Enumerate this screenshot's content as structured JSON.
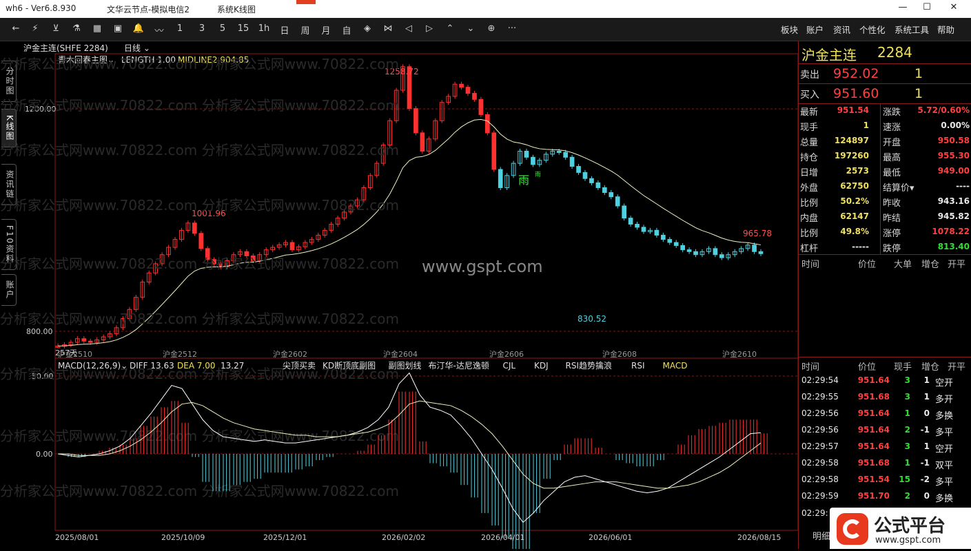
{
  "titlebar": {
    "left": "wh6 - Ver6.8.930",
    "center": "文华云节点-模拟电信2",
    "right": "系统K线图",
    "min": "—",
    "max": "☐",
    "close": "✕"
  },
  "toolbar": {
    "icons": [
      "←",
      "⚡",
      "⊻",
      "⚗",
      "▦",
      "▣",
      "🔔",
      "〰",
      "1",
      "3",
      "5",
      "15",
      "1h",
      "日",
      "周",
      "月",
      "自",
      "◈",
      "⋈",
      "◁",
      "▷",
      "⌃",
      "⌄",
      "⊕",
      "···"
    ],
    "menus": [
      "板块",
      "账户",
      "资讯",
      "个性化",
      "系统工具",
      "帮助"
    ]
  },
  "vtabs": [
    "分时图",
    "K线图",
    "资讯链",
    "F10资料",
    "账户"
  ],
  "header": {
    "symbol": "沪金主连(SHFE 2284)",
    "period": "日线",
    "indicator": "青木回春主图",
    "length": "LENGTH 1.00",
    "midline": "MIDLINE2 904.85"
  },
  "watermark_text": "www.gspt.com",
  "watermark_bg": "分析家公式网www.70822.com",
  "annotations": {
    "high": "1258.72",
    "peak1": "1001.96",
    "low": "830.52",
    "last_high": "965.78",
    "rain1": "雨",
    "rain2": "雨",
    "days": "257天"
  },
  "price_axis": [
    "1200.00",
    "800.00"
  ],
  "contract_labels": [
    "沪金2510",
    "沪金2512",
    "沪金2602",
    "沪金2604",
    "沪金2606",
    "沪金2608",
    "沪金2610"
  ],
  "macd": {
    "title": "MACD(12,26,9)",
    "diff": "DIFF 13.63",
    "dea": "DEA 7.00",
    "val": "13.27",
    "tabs": [
      "尖顶买卖",
      "KD断顶底副图",
      "副图划线",
      "布汀华-达尼逸顿",
      "CJL",
      "KDJ",
      "RSI趋势擒浪",
      "RSI",
      "MACD"
    ],
    "axis": [
      "50.00",
      "0.00"
    ]
  },
  "date_axis": [
    "2025/08/01",
    "2025/10/09",
    "2025/12/01",
    "2026/02/02",
    "2026/04/01",
    "2026/06/01",
    "2026/08/15"
  ],
  "quote": {
    "name": "沪金主连",
    "code": "2284",
    "sell": {
      "label": "卖出",
      "price": "952.02",
      "vol": "1"
    },
    "buy": {
      "label": "买入",
      "price": "951.60",
      "vol": "1"
    },
    "rows": [
      [
        "最新",
        "951.54",
        "red",
        "涨跌",
        "5.72/0.60%",
        "red"
      ],
      [
        "现手",
        "1",
        "yel",
        "速涨",
        "0.00%",
        "wht"
      ],
      [
        "总量",
        "124897",
        "yel",
        "开盘",
        "950.58",
        "red"
      ],
      [
        "持仓",
        "197260",
        "yel",
        "最高",
        "955.30",
        "red"
      ],
      [
        "日增",
        "2573",
        "yel",
        "最低",
        "949.00",
        "red"
      ],
      [
        "外盘",
        "62750",
        "yel",
        "结算价▾",
        "----",
        "wht"
      ],
      [
        "比例",
        "50.2%",
        "yel",
        "昨收",
        "943.16",
        "wht"
      ],
      [
        "内盘",
        "62147",
        "yel",
        "昨结",
        "945.82",
        "wht"
      ],
      [
        "比例",
        "49.8%",
        "yel",
        "涨停",
        "1078.22",
        "red"
      ],
      [
        "杠杆",
        "-----",
        "wht",
        "跌停",
        "813.40",
        "grn"
      ]
    ]
  },
  "t1_header": [
    "时间",
    "价位",
    "大单",
    "增仓",
    "开平"
  ],
  "t2_header": [
    "时间",
    "价位",
    "现手",
    "增仓",
    "开平"
  ],
  "ticks": [
    [
      "02:29:54",
      "951.64",
      "3",
      "1",
      "空开"
    ],
    [
      "02:29:55",
      "951.68",
      "3",
      "1",
      "多开"
    ],
    [
      "02:29:56",
      "951.64",
      "1",
      "0",
      "多换"
    ],
    [
      "02:29:56",
      "951.64",
      "2",
      "-1",
      "多平"
    ],
    [
      "02:29:57",
      "951.64",
      "3",
      "1",
      "空开"
    ],
    [
      "02:29:58",
      "951.68",
      "1",
      "-1",
      "双平"
    ],
    [
      "02:29:58",
      "951.54",
      "15",
      "-2",
      "多平"
    ],
    [
      "02:29:59",
      "951.70",
      "2",
      "0",
      "多换"
    ]
  ],
  "tick_last_time": "02:29:",
  "corner_logo": {
    "text": "公式平台",
    "url": "www.gspt.com"
  },
  "bottom_tab": "明细",
  "chart_data": {
    "type": "candlestick",
    "x_range": [
      "2025/08/01",
      "2026/08/15"
    ],
    "y_range": [
      780,
      1280
    ],
    "series": [
      {
        "name": "MIDLINE2",
        "values": []
      }
    ],
    "closes": [
      800,
      802,
      806,
      812,
      808,
      806,
      810,
      815,
      820,
      830,
      845,
      860,
      880,
      905,
      920,
      935,
      950,
      962,
      975,
      990,
      1001.96,
      985,
      960,
      942,
      935,
      930,
      940,
      950,
      955,
      948,
      940,
      950,
      958,
      962,
      966,
      970,
      958,
      963,
      970,
      975,
      982,
      990,
      1000,
      1010,
      1020,
      1030,
      1040,
      1060,
      1080,
      1100,
      1130,
      1170,
      1220,
      1258.72,
      1190,
      1150,
      1120,
      1140,
      1170,
      1200,
      1210,
      1230,
      1225,
      1215,
      1205,
      1180,
      1150,
      1090,
      1060,
      1080,
      1100,
      1120,
      1110,
      1098,
      1105,
      1115,
      1120,
      1118,
      1110,
      1095,
      1085,
      1075,
      1068,
      1060,
      1052,
      1045,
      1030,
      1010,
      1000,
      995,
      988,
      990,
      982,
      975,
      970,
      965,
      958,
      955,
      950,
      955,
      960,
      950,
      945,
      950,
      955,
      960,
      965.78,
      955,
      951.54
    ],
    "macd_diff": [
      0,
      -1,
      -2,
      -1,
      0,
      2,
      5,
      10,
      18,
      26,
      35,
      44,
      42,
      32,
      22,
      15,
      11,
      10,
      9,
      8,
      9,
      8,
      7,
      7,
      8,
      9,
      10,
      11,
      12,
      14,
      17,
      22,
      30,
      45,
      52,
      38,
      30,
      28,
      25,
      18,
      10,
      0,
      -10,
      -22,
      -35,
      -44,
      -38,
      -30,
      -24,
      -18,
      -15,
      -14,
      -16,
      -18,
      -20,
      -22,
      -24,
      -25,
      -24,
      -22,
      -18,
      -14,
      -10,
      -6,
      -2,
      3,
      8,
      13,
      13.63
    ],
    "macd_dea": [
      0,
      0,
      -1,
      -1,
      -1,
      0,
      2,
      5,
      9,
      14,
      20,
      27,
      32,
      33,
      31,
      27,
      23,
      20,
      18,
      16,
      15,
      14,
      13,
      12,
      12,
      11,
      11,
      11,
      12,
      13,
      14,
      16,
      19,
      25,
      32,
      34,
      33,
      32,
      31,
      28,
      24,
      19,
      13,
      5,
      -4,
      -13,
      -19,
      -22,
      -22,
      -21,
      -20,
      -19,
      -18,
      -18,
      -18,
      -19,
      -20,
      -21,
      -22,
      -22,
      -21,
      -20,
      -18,
      -15,
      -12,
      -8,
      -3,
      2,
      7.0
    ]
  }
}
